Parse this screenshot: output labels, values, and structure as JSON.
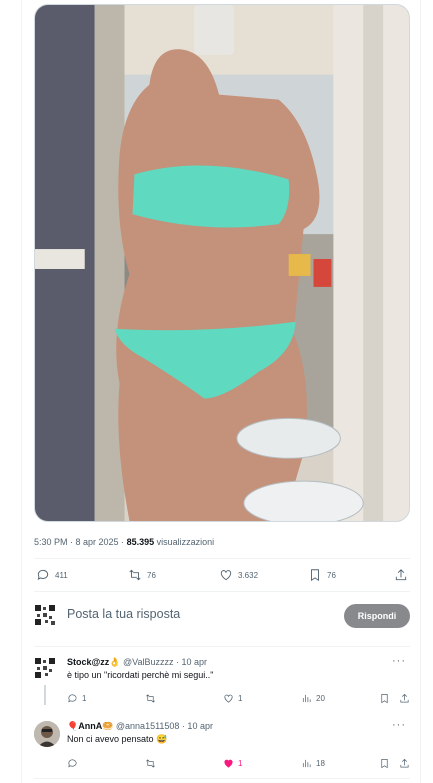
{
  "post": {
    "time": "5:30 PM",
    "sep1": " · ",
    "date": "8 apr 2025",
    "sep2": " · ",
    "views": "85.395",
    "views_label": " visualizzazioni",
    "replies": "411",
    "reposts": "76",
    "likes": "3.632",
    "bookmarks": "76"
  },
  "reply_box": {
    "placeholder": "Posta la tua risposta",
    "button": "Rispondi"
  },
  "comments": [
    {
      "name": "Stock@zz👌",
      "handle": " @ValBuzzzz · 10 apr",
      "text": "è tipo un \"ricordati perchè mi segui..\"",
      "replies": "1",
      "likes": "1",
      "views": "20"
    },
    {
      "name": "🎈AnnA🥯",
      "handle": " @anna1511508 · 10 apr",
      "text": "Non ci avevo pensato 😅",
      "likes": "1",
      "views": "18"
    }
  ],
  "more_glyph": "···",
  "colors": {
    "like_active": "#f91880",
    "button_gray": "#87898c",
    "swimsuit": "#5fd9c0"
  }
}
